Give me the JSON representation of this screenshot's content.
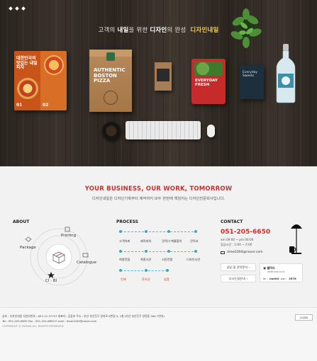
{
  "hero": {
    "tagline_pre": "고객의 ",
    "tagline_b1": "내일",
    "tagline_mid": "을 위한 ",
    "tagline_b2": "디자인",
    "tagline_post": "의 완성",
    "tagline_brand": "디자인내일",
    "magazine_title": "대한민국의 맛있는 내일피자",
    "magazine_num_left": "01",
    "magazine_num_right": "02",
    "pizzabox_text": "AUTHENTIC BOSTON PIZZA",
    "salad_text": "EVERYDAY FRESH",
    "box2_text": "Everyday Sweets"
  },
  "intro": {
    "headline": "YOUR BUSINESS, OUR WORK, TOMORROW",
    "subline": "디자인내일은 디자인기획부터 제작까지 모두 한번에 책임지는 디자인전문회사입니다."
  },
  "about": {
    "title": "ABOUT",
    "labels": {
      "package": "Package",
      "printing": "Printing",
      "catalogue": "Catalogue",
      "ci_bi": "CI · BI"
    }
  },
  "process": {
    "title": "PROCESS",
    "rows": [
      [
        "고객의뢰",
        "제작회의",
        "견적/스케쥴협의",
        "견적서"
      ],
      [
        "최종컨펌",
        "최종시안",
        "시안컨펌",
        "디자인시안"
      ],
      [
        "인쇄",
        "후가공",
        "납품"
      ]
    ]
  },
  "contact": {
    "title": "CONTACT",
    "phone": "051-205-6650",
    "hours": [
      "am 09:00 ~ pm 06:00",
      "점심시간 : 1:00 ~ 2:00"
    ],
    "email": "drew1004@naver.com",
    "btn_estimate": "상담 및 견적문의",
    "btn_directions": "오시는길안내",
    "login_title": "웹하드",
    "login_site": "webhard.co.kr",
    "login_id_label": "id :",
    "login_id": "naeild",
    "login_pw_label": "pw :",
    "login_pw": "3578"
  },
  "footer": {
    "line1": "상호 : 디자인내일      사업자번호 : 603-12-37707      대표자 : 김동호      주소 : 부산 부산진구 양지로 6번길 5, 1층 (부산 부산진구 양정동 364-7번지)",
    "line2": "Tel : 051-205-6650      Fax : 051-202-6650      E-mail : drew1004@naver.com",
    "line3": "COPYRIGHT © KAYWA ALL RIGHTS RESERVED.",
    "login_label": "LOGIN"
  }
}
